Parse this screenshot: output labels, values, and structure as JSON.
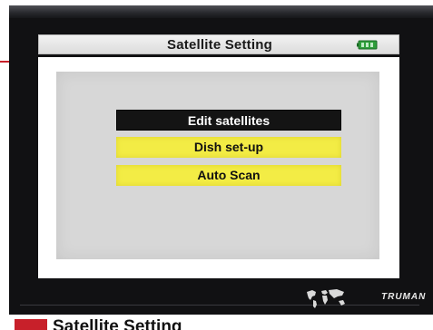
{
  "header": {
    "title": "Satellite Setting",
    "battery_icon": "battery-icon",
    "battery_color": "#2e9e3a"
  },
  "menu": {
    "items": [
      {
        "label": "Edit satellites",
        "selected": true
      },
      {
        "label": "Dish set-up",
        "selected": false
      },
      {
        "label": "Auto Scan",
        "selected": false
      }
    ],
    "selected_color": "#141414",
    "item_color": "#f3ec45"
  },
  "footer": {
    "map_icon": "world-map-icon",
    "brand": "TRUMAN"
  },
  "caption": {
    "text": "Satellite Setting"
  },
  "colors": {
    "accent": "#c8202a",
    "screen": "#111113",
    "panel": "#d7d7d7"
  }
}
